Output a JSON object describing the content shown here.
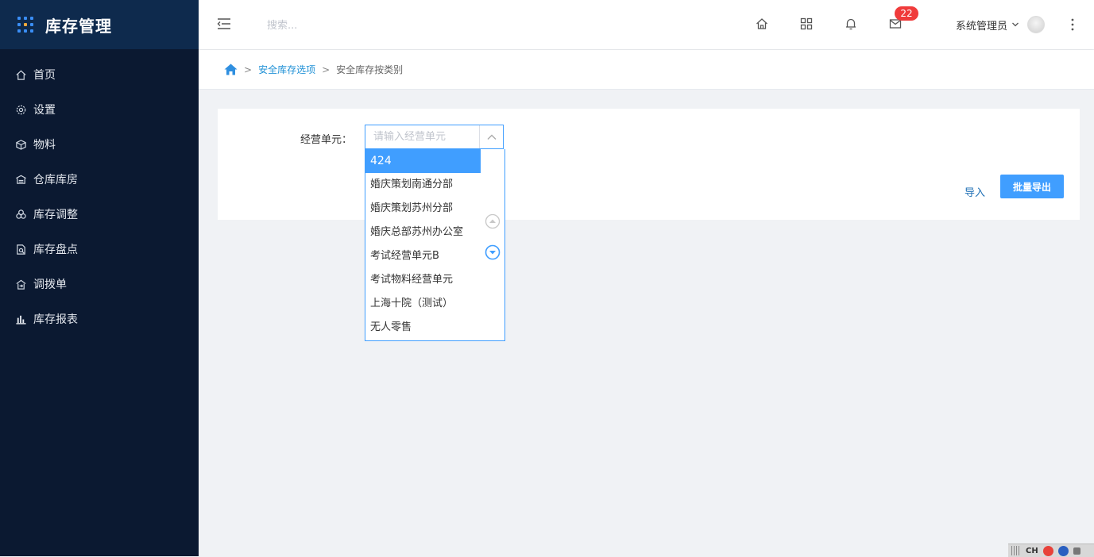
{
  "brand": {
    "title": "库存管理"
  },
  "sidebar": {
    "items": [
      {
        "label": "首页",
        "icon": "home-icon"
      },
      {
        "label": "设置",
        "icon": "gear-icon"
      },
      {
        "label": "物料",
        "icon": "cube-icon"
      },
      {
        "label": "仓库库房",
        "icon": "warehouse-icon"
      },
      {
        "label": "库存调整",
        "icon": "adjust-icon"
      },
      {
        "label": "库存盘点",
        "icon": "inventory-check-icon"
      },
      {
        "label": "调拨单",
        "icon": "transfer-icon"
      },
      {
        "label": "库存报表",
        "icon": "bar-chart-icon"
      }
    ]
  },
  "header": {
    "search_placeholder": "搜索...",
    "mail_badge": "22",
    "user_name": "系统管理员"
  },
  "breadcrumb": {
    "items": [
      "安全库存选项",
      "安全库存按类别"
    ],
    "separator": ">"
  },
  "form": {
    "business_unit_label": "经营单元：",
    "business_unit_placeholder": "请输入经营单元",
    "import_label": "导入",
    "export_label": "批量导出"
  },
  "dropdown": {
    "options": [
      "424",
      "婚庆策划南通分部",
      "婚庆策划苏州分部",
      "婚庆总部苏州办公室",
      "考试经营单元B",
      "考试物料经营单元",
      "上海十院（测试）",
      "无人零售"
    ],
    "highlighted_index": 0
  },
  "tray": {
    "ime": "CH"
  },
  "colors": {
    "sidebar_bg": "#0b1931",
    "brand_bg": "#0e2a4d",
    "accent": "#409eff",
    "badge": "#f03b3b",
    "link": "#1e90d6"
  }
}
